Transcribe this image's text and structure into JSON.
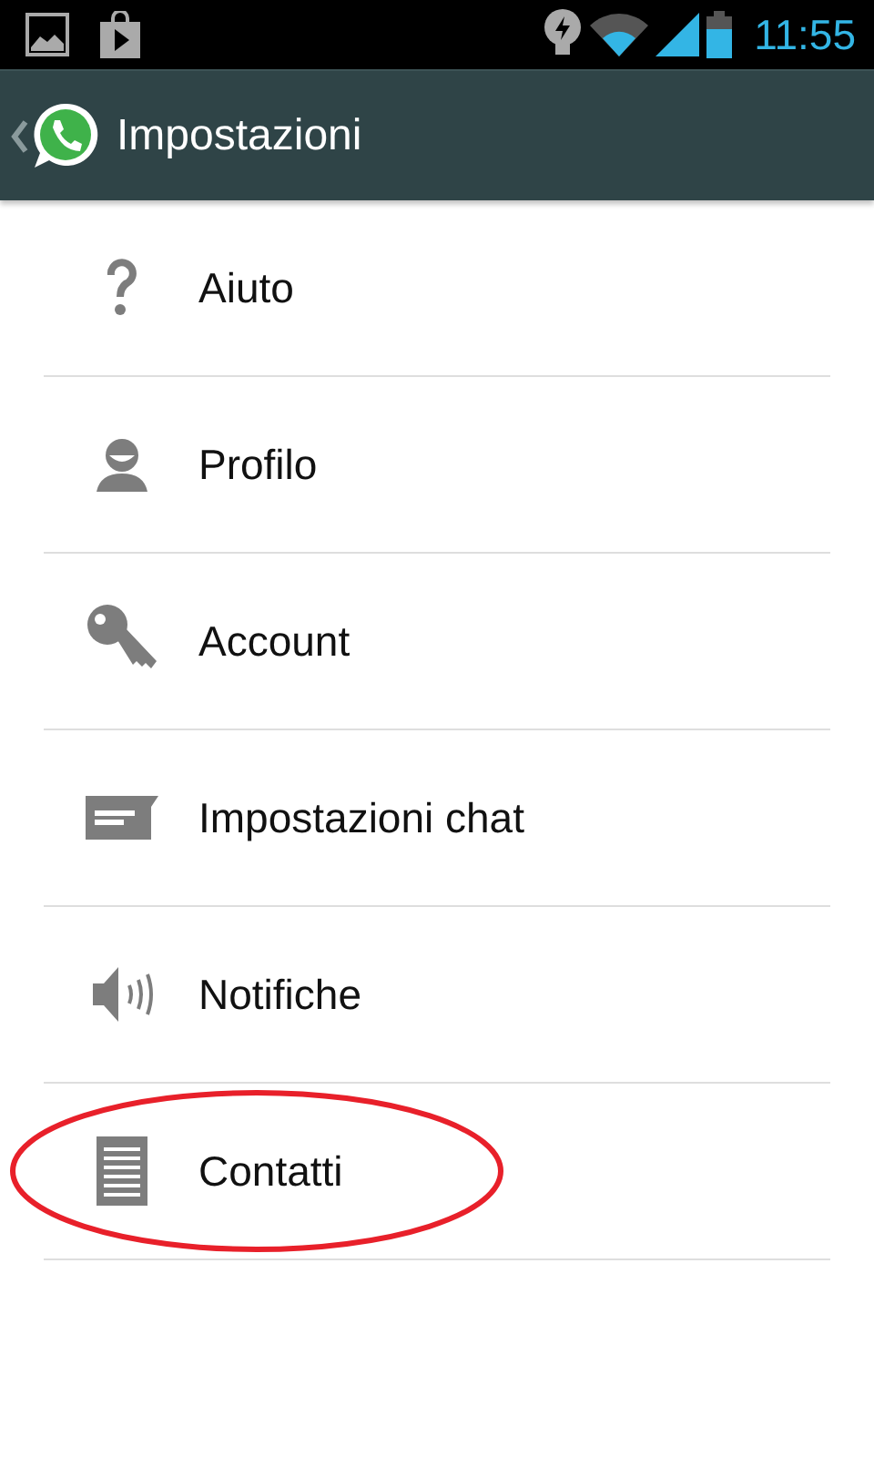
{
  "status_bar": {
    "time": "11:55"
  },
  "action_bar": {
    "title": "Impostazioni"
  },
  "items": [
    {
      "label": "Aiuto",
      "kind": "help",
      "circled": false
    },
    {
      "label": "Profilo",
      "kind": "profile",
      "circled": false
    },
    {
      "label": "Account",
      "kind": "key",
      "circled": false
    },
    {
      "label": "Impostazioni chat",
      "kind": "chat",
      "circled": false
    },
    {
      "label": "Notifiche",
      "kind": "sound",
      "circled": false
    },
    {
      "label": "Contatti",
      "kind": "contacts",
      "circled": true
    }
  ]
}
